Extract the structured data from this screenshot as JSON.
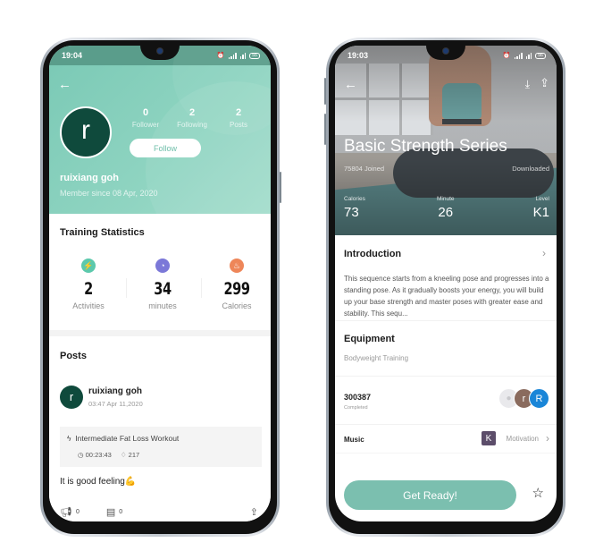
{
  "profile_screen": {
    "status_bar": {
      "time": "19:04",
      "battery": "55"
    },
    "back_icon": "arrow-left-icon",
    "avatar_initial": "r",
    "counts": [
      {
        "value": "0",
        "label": "Follower"
      },
      {
        "value": "2",
        "label": "Following"
      },
      {
        "value": "2",
        "label": "Posts"
      }
    ],
    "follow_label": "Follow",
    "username": "ruixiang goh",
    "member_since": "Member since 08 Apr, 2020",
    "training_statistics": {
      "title": "Training Statistics",
      "items": [
        {
          "icon": "lightning-icon",
          "value": "2",
          "label": "Activities",
          "color": "#5cc9ac"
        },
        {
          "icon": "timer-icon",
          "value": "34",
          "label": "minutes",
          "color": "#7b78d8"
        },
        {
          "icon": "flame-icon",
          "value": "299",
          "label": "Calories",
          "color": "#ee8659"
        }
      ]
    },
    "posts": {
      "title": "Posts",
      "items": [
        {
          "avatar_initial": "r",
          "author": "ruixiang goh",
          "time": "03:47 Apr 11,2020",
          "workout": "Intermediate Fat Loss Workout",
          "duration": "00:23:43",
          "calories": "217",
          "text": "It is good feeling💪",
          "likes": "0",
          "comments": "0"
        }
      ]
    }
  },
  "course_screen": {
    "status_bar": {
      "time": "19:03",
      "battery": "56"
    },
    "title": "Basic Strength Series",
    "joined": "75804 Joined",
    "downloaded": "Downloaded",
    "stats": [
      {
        "label": "Calories",
        "value": "73"
      },
      {
        "label": "Minute",
        "value": "26"
      },
      {
        "label": "Level",
        "value": "K1"
      }
    ],
    "introduction": {
      "title": "Introduction",
      "text": "This sequence starts from a kneeling pose and progresses into a standing pose. As it gradually boosts your energy, you will build up your base strength and master poses with greater ease and stability. This sequ..."
    },
    "equipment": {
      "title": "Equipment",
      "value": "Bodyweight Training"
    },
    "completed": {
      "count": "300387",
      "label": "Completed",
      "avatars": [
        "",
        "r",
        "R"
      ]
    },
    "music": {
      "label": "Music",
      "icon_letter": "K",
      "value": "Motivation"
    },
    "cta_label": "Get Ready!"
  }
}
